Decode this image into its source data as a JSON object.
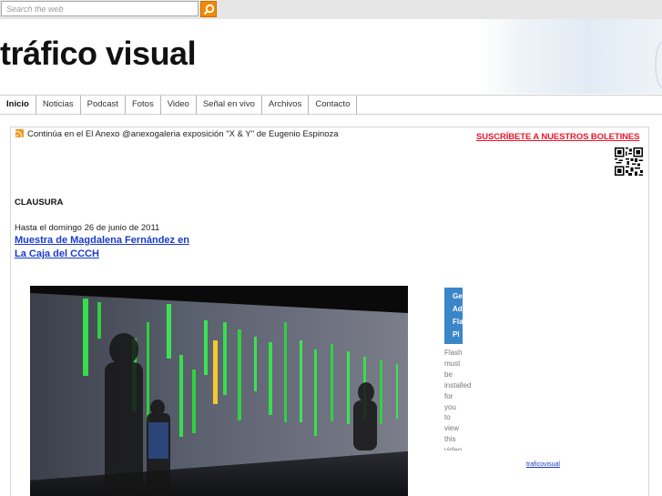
{
  "search": {
    "placeholder": "Search the web"
  },
  "site": {
    "title": "tráfico visual"
  },
  "nav": {
    "items": [
      {
        "label": "Inicio"
      },
      {
        "label": "Noticias"
      },
      {
        "label": "Podcast"
      },
      {
        "label": "Fotos"
      },
      {
        "label": "Video"
      },
      {
        "label": "Señal en vivo"
      },
      {
        "label": "Archivos"
      },
      {
        "label": "Contacto"
      }
    ]
  },
  "ticker": {
    "text": "Continúa en el El Anexo @anexogaleria exposición \"X & Y\" de Eugenio Espinoza"
  },
  "sidebar": {
    "subscribe": "SUSCRÍBETE A NUESTROS BOLETINES"
  },
  "post": {
    "heading": "CLAUSURA",
    "date_line": "Hasta el domingo 26 de junio de 2011",
    "link_line1": "Muestra de Magdalena Fernández en",
    "link_line2": "La Caja del CCCH"
  },
  "flash": {
    "button_lines": [
      "Ge",
      "Ad",
      "Fla",
      "Pl"
    ],
    "message_words": [
      "Flash",
      "must",
      "be",
      "installed",
      "for",
      "you",
      "to",
      "view",
      "this",
      "video"
    ],
    "link": "traficovisual"
  },
  "colors": {
    "accent_orange": "#f08a00",
    "subscribe_red": "#e8172b",
    "link_blue": "#1a3acb",
    "flash_blue": "#3b86c9"
  }
}
